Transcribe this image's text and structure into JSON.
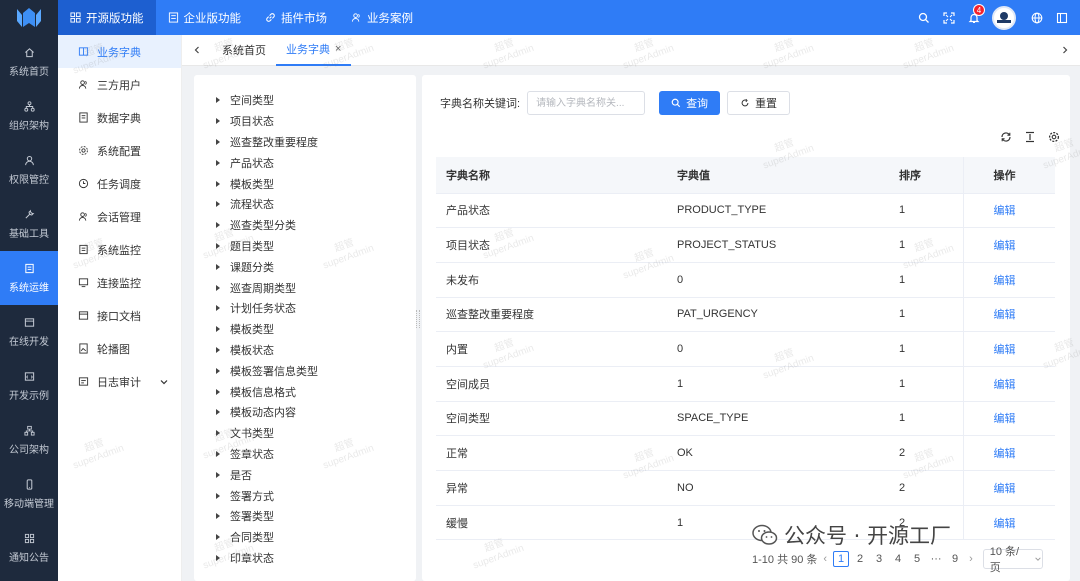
{
  "topnav": {
    "items": [
      {
        "label": "开源版功能",
        "active": true
      },
      {
        "label": "企业版功能",
        "active": false
      },
      {
        "label": "插件市场",
        "active": false
      },
      {
        "label": "业务案例",
        "active": false
      }
    ],
    "notification_count": "4"
  },
  "sidebar": {
    "items": [
      {
        "label": "系统首页",
        "icon": "home-icon"
      },
      {
        "label": "组织架构",
        "icon": "org-icon"
      },
      {
        "label": "权限管控",
        "icon": "user-icon"
      },
      {
        "label": "基础工具",
        "icon": "wrench-icon"
      },
      {
        "label": "系统运维",
        "icon": "ops-icon",
        "active": true
      },
      {
        "label": "在线开发",
        "icon": "window-icon"
      },
      {
        "label": "开发示例",
        "icon": "code-icon"
      },
      {
        "label": "公司架构",
        "icon": "company-icon"
      },
      {
        "label": "移动端管理",
        "icon": "mobile-icon"
      },
      {
        "label": "通知公告",
        "icon": "grid-icon"
      }
    ]
  },
  "submenu": {
    "items": [
      {
        "label": "业务字典",
        "active": true
      },
      {
        "label": "三方用户"
      },
      {
        "label": "数据字典"
      },
      {
        "label": "系统配置"
      },
      {
        "label": "任务调度"
      },
      {
        "label": "会话管理"
      },
      {
        "label": "系统监控"
      },
      {
        "label": "连接监控"
      },
      {
        "label": "接口文档"
      },
      {
        "label": "轮播图"
      },
      {
        "label": "日志审计"
      }
    ]
  },
  "tabs": {
    "items": [
      {
        "label": "系统首页"
      },
      {
        "label": "业务字典",
        "active": true,
        "close": "×"
      }
    ]
  },
  "tree": {
    "nodes": [
      "空间类型",
      "项目状态",
      "巡查整改重要程度",
      "产品状态",
      "模板类型",
      "流程状态",
      "巡查类型分类",
      "题目类型",
      "课题分类",
      "巡查周期类型",
      "计划任务状态",
      "模板类型",
      "模板状态",
      "模板签署信息类型",
      "模板信息格式",
      "模板动态内容",
      "文书类型",
      "签章状态",
      "是否",
      "签署方式",
      "签署类型",
      "合同类型",
      "印章状态"
    ]
  },
  "search": {
    "label": "字典名称关键词:",
    "placeholder": "请输入字典名称关...",
    "query_label": "查询",
    "reset_label": "重置"
  },
  "table": {
    "headers": [
      "字典名称",
      "字典值",
      "排序",
      "操作"
    ],
    "edit_label": "编辑",
    "rows": [
      {
        "name": "产品状态",
        "value": "PRODUCT_TYPE",
        "sort": "1"
      },
      {
        "name": "项目状态",
        "value": "PROJECT_STATUS",
        "sort": "1"
      },
      {
        "name": "未发布",
        "value": "0",
        "sort": "1"
      },
      {
        "name": "巡查整改重要程度",
        "value": "PAT_URGENCY",
        "sort": "1"
      },
      {
        "name": "内置",
        "value": "0",
        "sort": "1"
      },
      {
        "name": "空间成员",
        "value": "1",
        "sort": "1"
      },
      {
        "name": "空间类型",
        "value": "SPACE_TYPE",
        "sort": "1"
      },
      {
        "name": "正常",
        "value": "OK",
        "sort": "2"
      },
      {
        "name": "异常",
        "value": "NO",
        "sort": "2"
      },
      {
        "name": "缓慢",
        "value": "1",
        "sort": "2"
      }
    ]
  },
  "pagination": {
    "summary": "1-10 共 90 条",
    "pages": [
      "1",
      "2",
      "3",
      "4",
      "5",
      "···",
      "9"
    ],
    "current": "1",
    "page_size": "10 条/页"
  },
  "watermark": {
    "line1": "超管",
    "line2": "superAdmin",
    "wechat_text": "公众号 · 开源工厂"
  },
  "colors": {
    "primary": "#2f7cf6",
    "sidebar_bg": "#1e2a3d",
    "badge": "#f5222d"
  }
}
